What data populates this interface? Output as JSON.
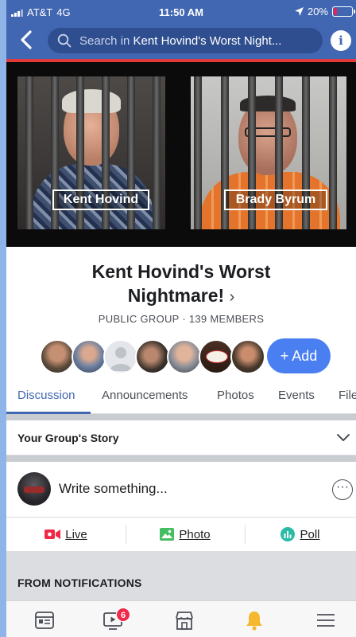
{
  "status": {
    "carrier": "AT&T",
    "network": "4G",
    "time": "11:50 AM",
    "battery": "20%",
    "battery_level": 0.2
  },
  "nav": {
    "search_prefix": "Search in ",
    "search_group": "Kent Hovind's Worst Night...",
    "info_label": "i"
  },
  "cover": {
    "left_name": "Kent Hovind",
    "right_name": "Brady Byrum"
  },
  "group": {
    "title_line1": "Kent Hovind's Worst",
    "title_line2": "Nightmare!",
    "title_chevron": "›",
    "subtitle": "PUBLIC GROUP · 139 MEMBERS",
    "add_label": "+ Add"
  },
  "tabs": [
    {
      "label": "Discussion"
    },
    {
      "label": "Announcements"
    },
    {
      "label": "Photos"
    },
    {
      "label": "Events"
    },
    {
      "label": "Files"
    }
  ],
  "story": {
    "label": "Your Group's Story"
  },
  "composer": {
    "placeholder": "Write something...",
    "more_label": "···"
  },
  "actions": {
    "live": "Live",
    "photo": "Photo",
    "poll": "Poll"
  },
  "notifications": {
    "label": "FROM NOTIFICATIONS"
  },
  "bottom_nav": {
    "video_badge": "6"
  },
  "colors": {
    "brand": "#4267b2",
    "accent": "#4a7ff2",
    "live": "#f02849",
    "photo": "#45bd62",
    "poll": "#2abba7"
  }
}
